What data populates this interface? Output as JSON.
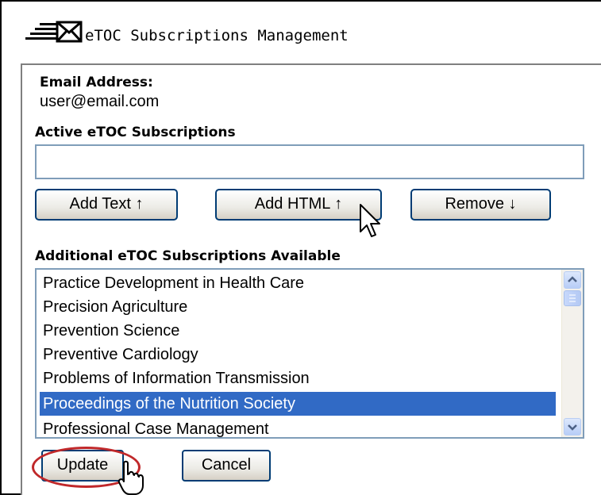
{
  "window": {
    "title": "eTOC Subscriptions Management"
  },
  "email": {
    "label": "Email Address:",
    "value": "user@email.com"
  },
  "active": {
    "label": "Active eTOC Subscriptions",
    "value": ""
  },
  "buttons": {
    "add_text": "Add Text ↑",
    "add_html": "Add HTML ↑",
    "remove": "Remove ↓",
    "update": "Update",
    "cancel": "Cancel"
  },
  "available": {
    "label": "Additional eTOC Subscriptions Available",
    "items": [
      "Practice Development in Health Care",
      "Precision Agriculture",
      "Prevention Science",
      "Preventive Cardiology",
      "Problems of Information Transmission",
      "Proceedings of the Nutrition Society",
      "Professional Case Management"
    ],
    "selected_item": "Proceedings of the Nutrition Society"
  },
  "icons": {
    "title": "mail-envelope-icon",
    "scroll_up": "chevron-up-icon",
    "scroll_down": "chevron-down-icon",
    "cursor_arrow": "arrow-cursor-icon",
    "cursor_hand": "hand-cursor-icon"
  },
  "colors": {
    "selection": "#316ac5",
    "border": "#7f9db9",
    "button_border": "#003c74",
    "annotation_ring": "#c0282a"
  }
}
